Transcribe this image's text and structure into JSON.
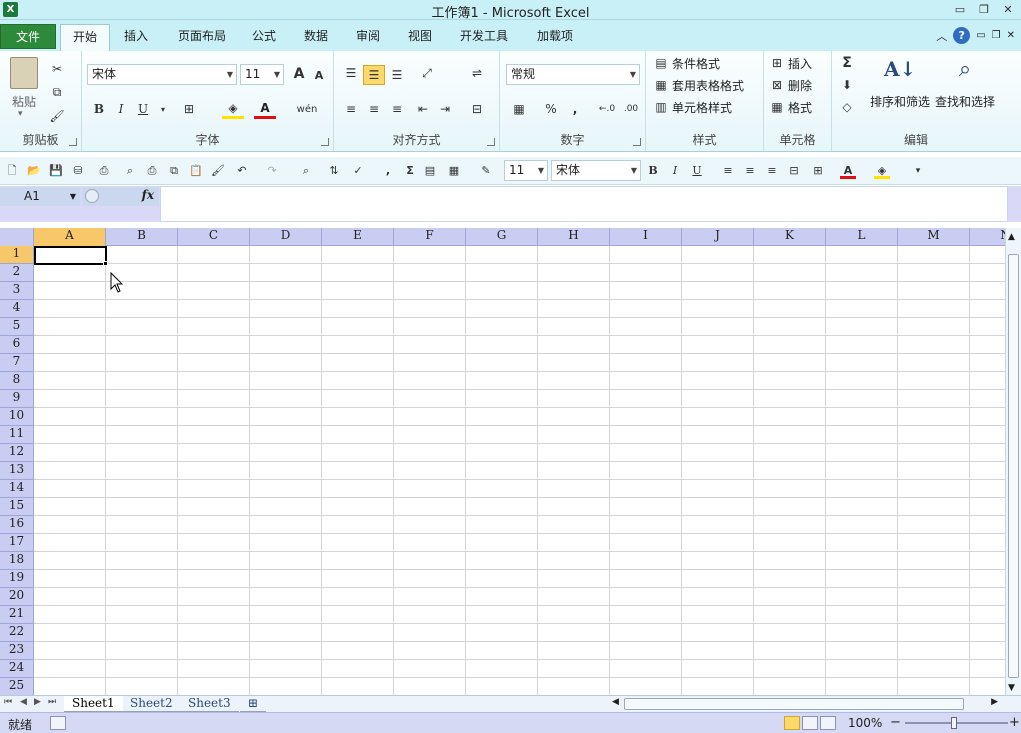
{
  "window": {
    "title": "工作簿1 - Microsoft Excel",
    "minimize_glyph": "▭",
    "restore_glyph": "❐",
    "close_glyph": "✕",
    "app_glyph": "X"
  },
  "ribbon_tabs": {
    "file": "文件",
    "tabs": [
      "开始",
      "插入",
      "页面布局",
      "公式",
      "数据",
      "审阅",
      "视图",
      "开发工具",
      "加载项"
    ],
    "active_index": 0,
    "help_glyph": "?"
  },
  "clipboard": {
    "paste": "粘贴",
    "label": "剪贴板"
  },
  "font_group": {
    "font_name": "宋体",
    "font_size": "11",
    "label": "字体",
    "bold": "B",
    "italic": "I",
    "underline": "U",
    "grow": "A",
    "shrink": "A",
    "font_color": "A",
    "phonetic": "wén"
  },
  "align_group": {
    "label": "对齐方式"
  },
  "number_group": {
    "format": "常规",
    "label": "数字",
    "percent": "%",
    "comma": ",",
    "inc_decimal": "←.0",
    "dec_decimal": ".00"
  },
  "styles_group": {
    "conditional": "条件格式",
    "table": "套用表格格式",
    "cell_styles": "单元格样式",
    "label": "样式"
  },
  "cells_group": {
    "insert": "插入",
    "delete": "删除",
    "format": "格式",
    "label": "单元格"
  },
  "editing_group": {
    "sum": "Σ",
    "sort_filter": "排序和筛选",
    "find_select": "查找和选择",
    "label": "编辑"
  },
  "quick_toolbar": {
    "font_size": "11",
    "font_name": "宋体",
    "bold": "B",
    "italic": "I",
    "underline": "U",
    "font_color": "A"
  },
  "formula_bar": {
    "name_box": "A1",
    "fx": "fx",
    "formula": ""
  },
  "grid": {
    "columns": [
      "A",
      "B",
      "C",
      "D",
      "E",
      "F",
      "G",
      "H",
      "I",
      "J",
      "K",
      "L",
      "M",
      "N"
    ],
    "rows": [
      "1",
      "2",
      "3",
      "4",
      "5",
      "6",
      "7",
      "8",
      "9",
      "10",
      "11",
      "12",
      "13",
      "14",
      "15",
      "16",
      "17",
      "18",
      "19",
      "20",
      "21",
      "22",
      "23",
      "24",
      "25"
    ],
    "active_cell": "A1"
  },
  "sheets": {
    "tabs": [
      "Sheet1",
      "Sheet2",
      "Sheet3"
    ],
    "active_index": 0
  },
  "status": {
    "ready": "就绪",
    "zoom": "100%",
    "zoom_out": "−",
    "zoom_in": "+"
  }
}
